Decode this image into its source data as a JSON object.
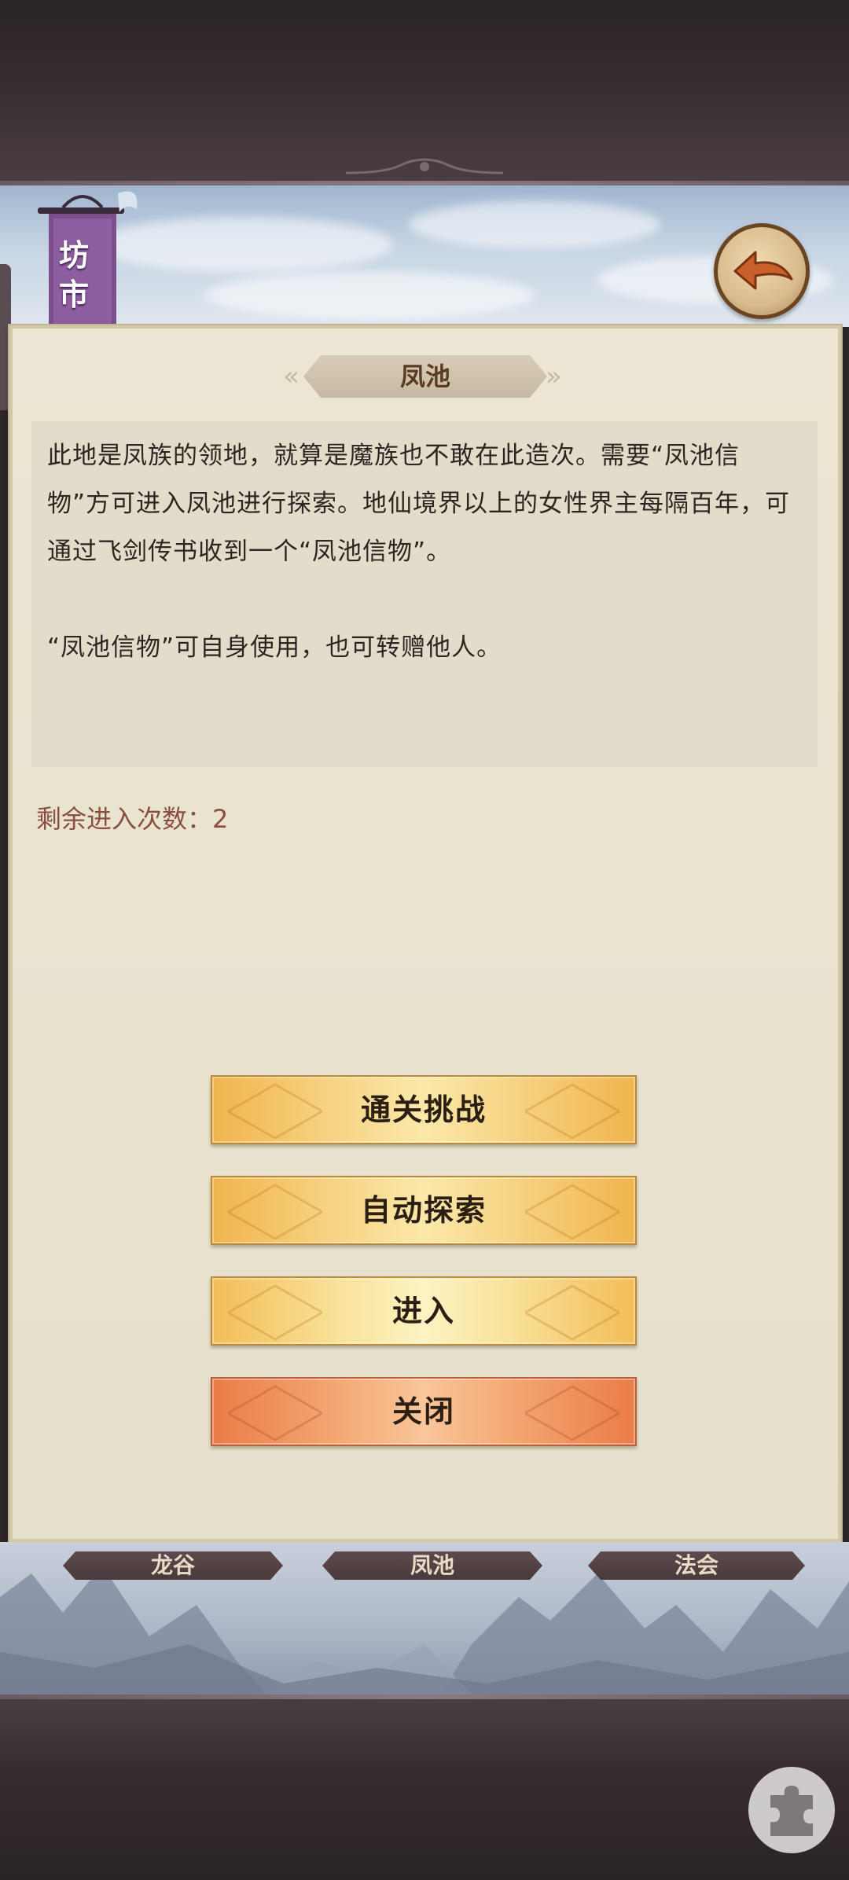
{
  "header": {
    "banner_label": "坊市",
    "back_icon": "back-arrow-icon"
  },
  "dialog": {
    "title": "凤池",
    "description": [
      "此地是凤族的领地，就算是魔族也不敢在此造次。需要“凤池信物”方可进入凤池进行探索。地仙境界以上的女性界主每隔百年，可通过飞剑传书收到一个“凤池信物”。",
      "“凤池信物”可自身使用，也可转赠他人。"
    ],
    "remaining_label": "剩余进入次数：2",
    "buttons": {
      "challenge": "通关挑战",
      "auto_explore": "自动探索",
      "enter": "进入",
      "close": "关闭"
    }
  },
  "locations": [
    "龙谷",
    "凤池",
    "法会"
  ],
  "floating": {
    "puzzle_icon": "puzzle-icon"
  },
  "colors": {
    "panel": "#e8e3cf",
    "title_text": "#5a3a22",
    "remaining_text": "#8a4f3e",
    "button_gold": "#f0b44c",
    "button_close": "#ea7c48"
  }
}
